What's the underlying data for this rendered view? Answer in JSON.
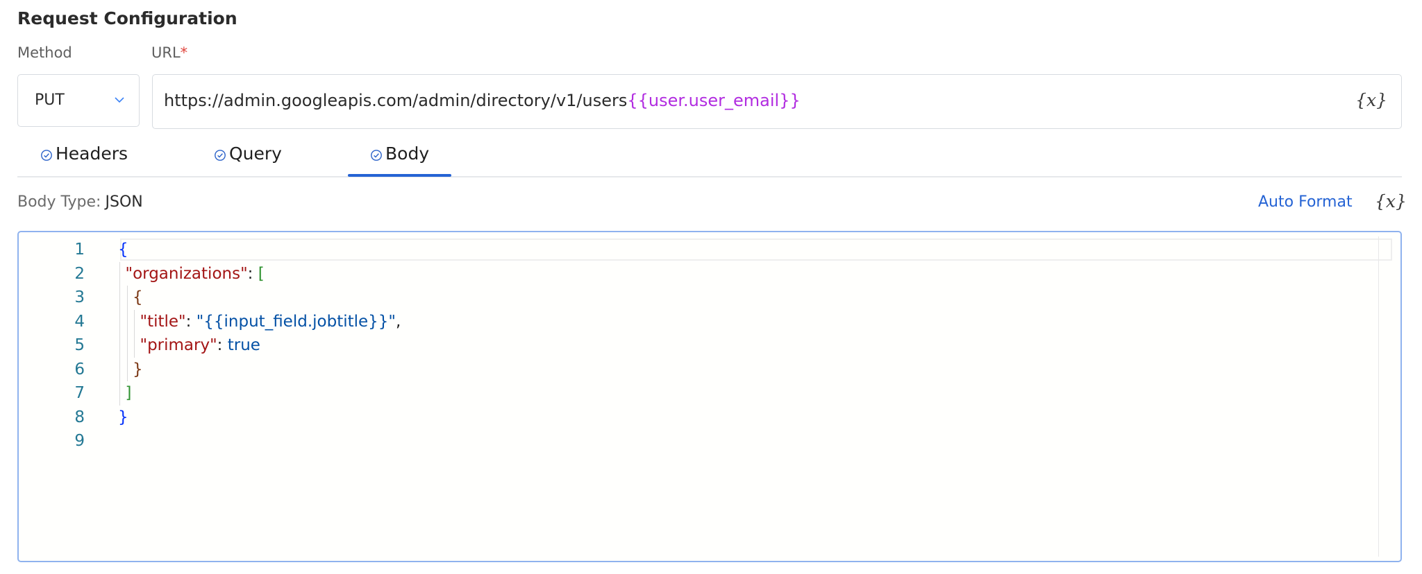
{
  "section_title": "Request Configuration",
  "method": {
    "label": "Method",
    "value": "PUT"
  },
  "url": {
    "label": "URL",
    "required_mark": "*",
    "base": "https://admin.googleapis.com/admin/directory/v1/users",
    "variable": "{{user.user_email}}",
    "variable_icon": "{x}"
  },
  "tabs": [
    {
      "label": "Headers",
      "active": false
    },
    {
      "label": "Query",
      "active": false
    },
    {
      "label": "Body",
      "active": true
    }
  ],
  "body": {
    "type_label": "Body Type:",
    "type_value": "JSON",
    "auto_format_label": "Auto Format",
    "variable_icon": "{x}"
  },
  "editor": {
    "lines": [
      {
        "n": "1",
        "indent": 0,
        "tokens": [
          [
            "{",
            "brace0"
          ]
        ]
      },
      {
        "n": "2",
        "indent": 1,
        "tokens": [
          [
            "\"organizations\"",
            "key"
          ],
          [
            ": ",
            "punc"
          ],
          [
            "[",
            "bracket"
          ]
        ]
      },
      {
        "n": "3",
        "indent": 2,
        "tokens": [
          [
            "{",
            "brace2"
          ]
        ]
      },
      {
        "n": "4",
        "indent": 3,
        "tokens": [
          [
            "\"title\"",
            "key"
          ],
          [
            ": ",
            "punc"
          ],
          [
            "\"{{input_field.jobtitle}}\"",
            "str"
          ],
          [
            ",",
            "punc"
          ]
        ]
      },
      {
        "n": "5",
        "indent": 3,
        "tokens": [
          [
            "\"primary\"",
            "key"
          ],
          [
            ": ",
            "punc"
          ],
          [
            "true",
            "bool"
          ]
        ]
      },
      {
        "n": "6",
        "indent": 2,
        "tokens": [
          [
            "}",
            "brace2"
          ]
        ]
      },
      {
        "n": "7",
        "indent": 1,
        "tokens": [
          [
            "]",
            "bracket"
          ]
        ]
      },
      {
        "n": "8",
        "indent": 0,
        "tokens": [
          [
            "}",
            "brace0"
          ]
        ]
      },
      {
        "n": "9",
        "indent": 0,
        "tokens": []
      }
    ]
  },
  "colors": {
    "accent": "#2563d4",
    "url_variable": "#b12ce0",
    "required": "#e0443c",
    "editor_border": "#8fb2ee"
  }
}
